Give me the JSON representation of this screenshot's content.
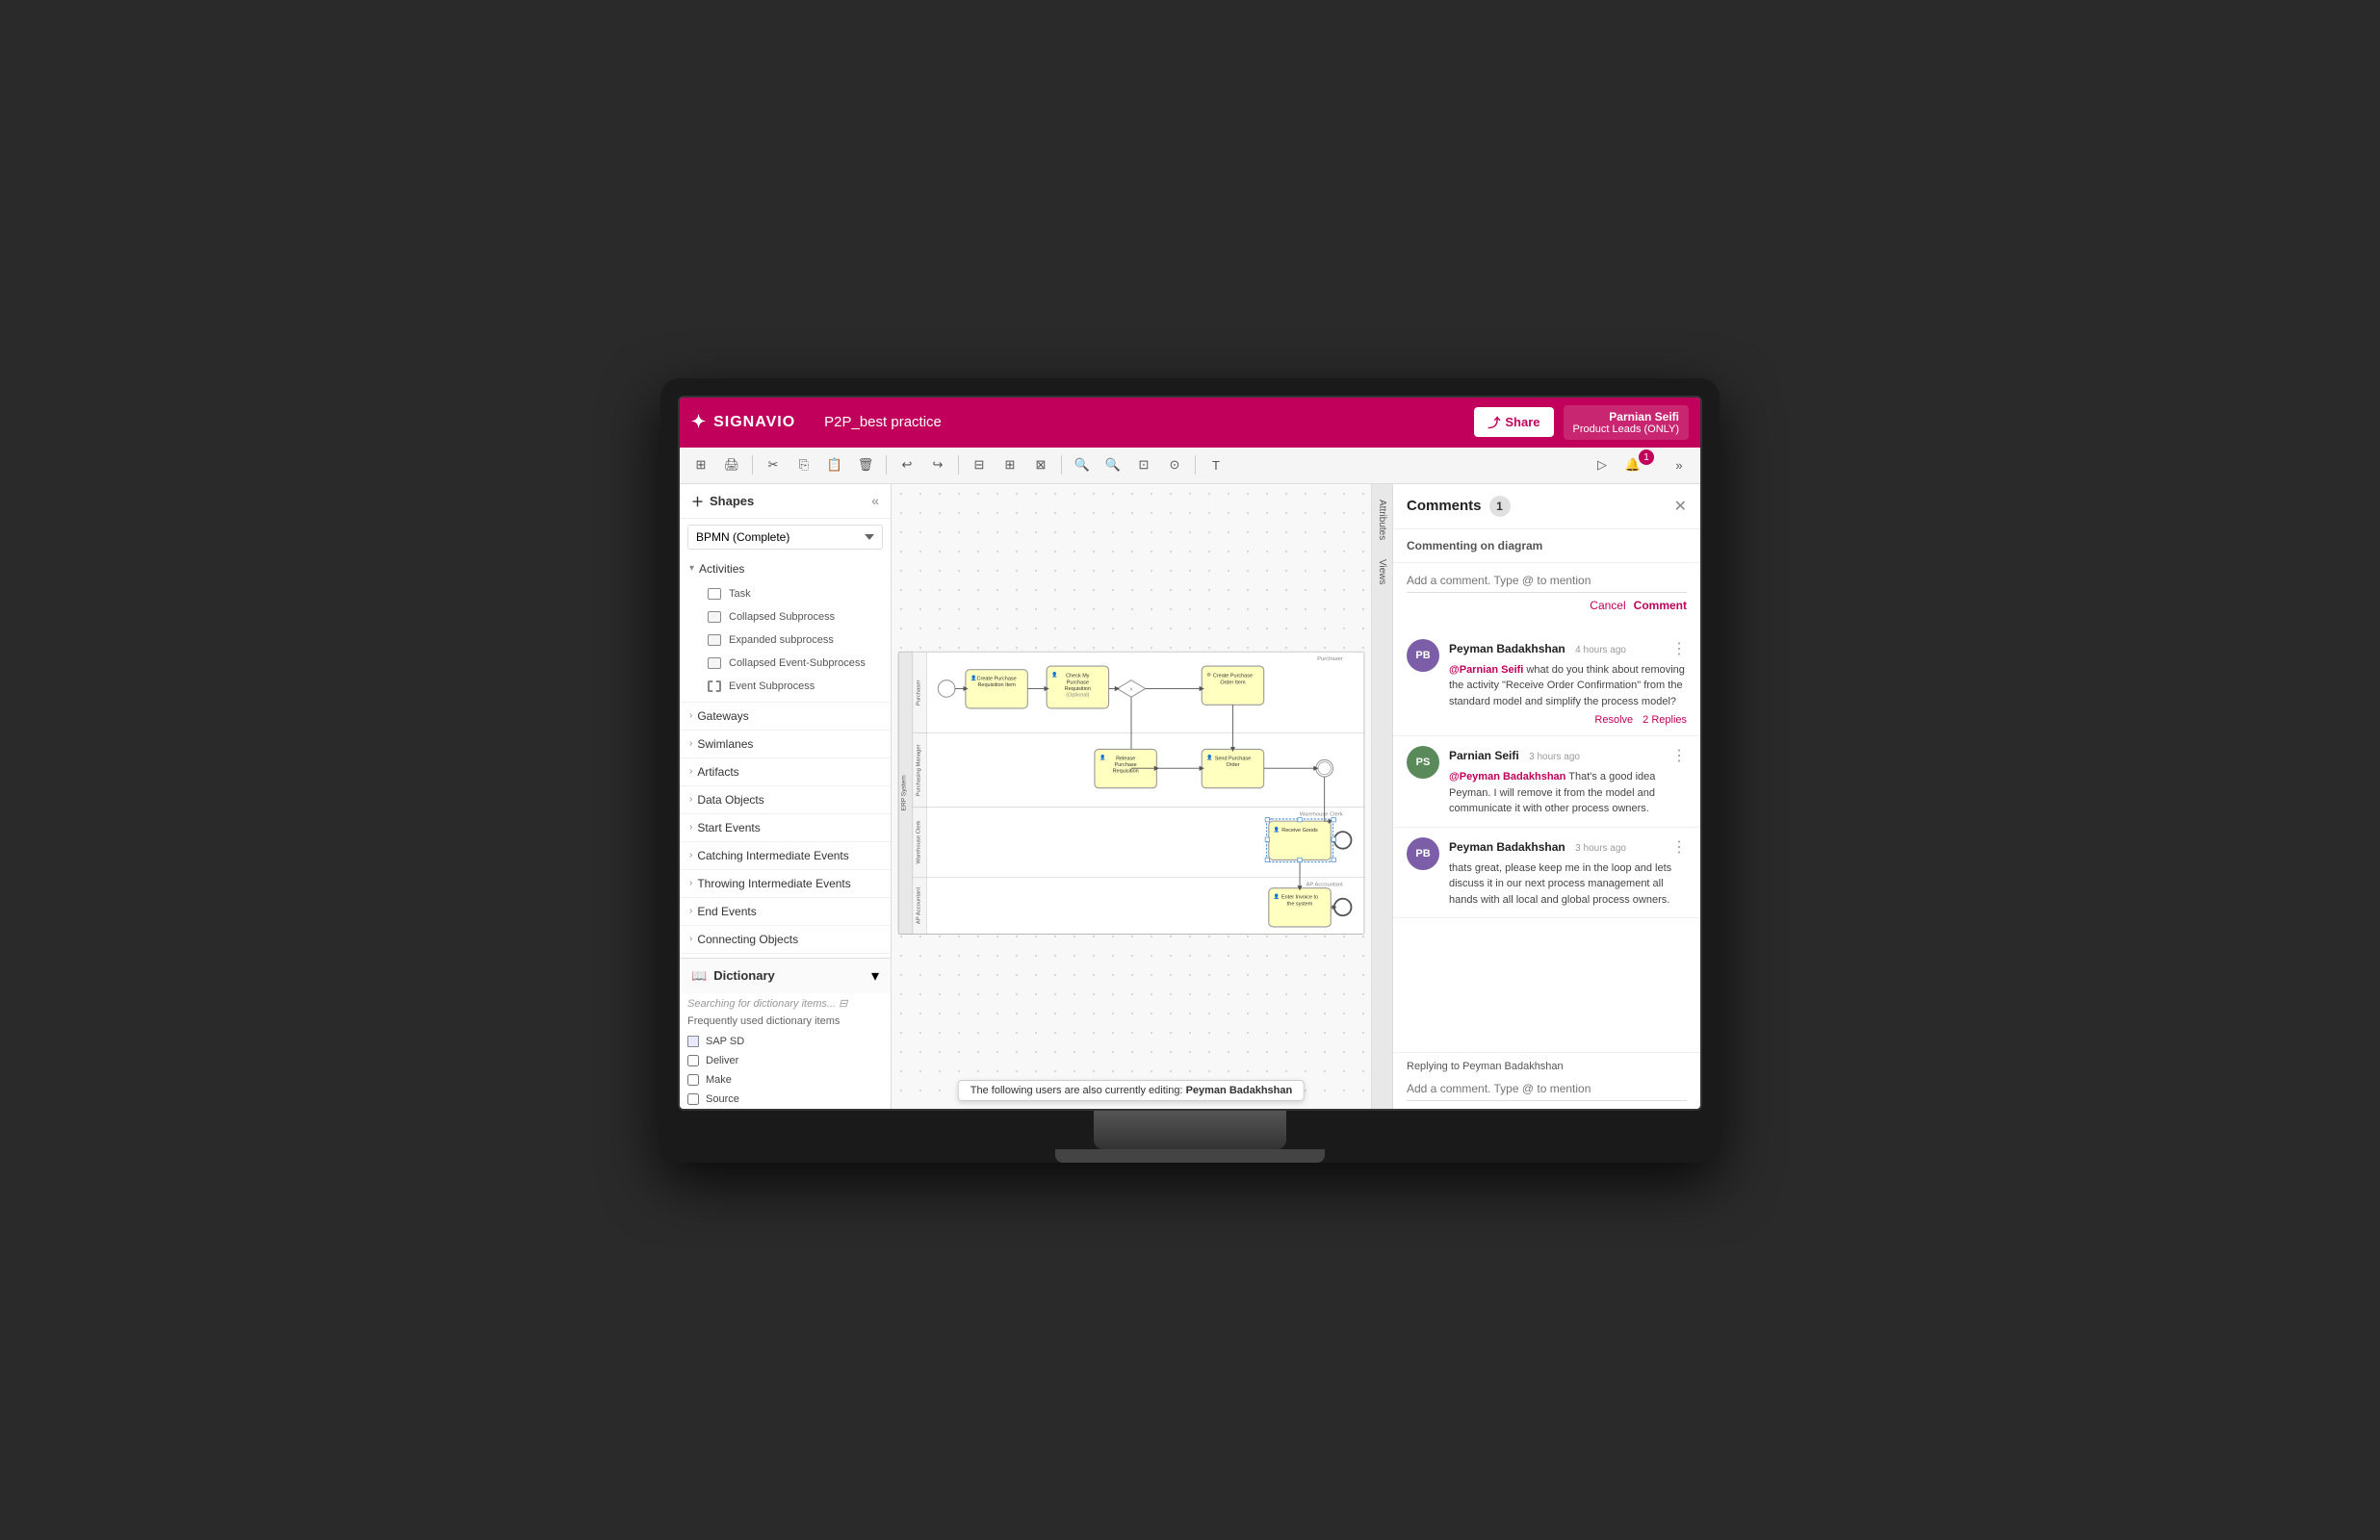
{
  "app": {
    "title": "SIGNAVIO",
    "diagram_name": "P2P_best practice"
  },
  "topbar": {
    "share_label": "Share",
    "user_name": "Parnian Seifi",
    "user_role": "Product Leads (ONLY)"
  },
  "left_panel": {
    "title": "Shapes",
    "bpmn_type": "BPMN (Complete)",
    "categories": [
      {
        "id": "activities",
        "label": "Activities",
        "items": [
          {
            "label": "Task",
            "icon": "task"
          },
          {
            "label": "Collapsed Subprocess",
            "icon": "collapsed"
          },
          {
            "label": "Expanded subprocess",
            "icon": "expanded"
          },
          {
            "label": "Collapsed Event-Subprocess",
            "icon": "collapsed"
          },
          {
            "label": "Event Subprocess",
            "icon": "dashed"
          }
        ]
      },
      {
        "id": "gateways",
        "label": "Gateways",
        "items": []
      },
      {
        "id": "swimlanes",
        "label": "Swimlanes",
        "items": []
      },
      {
        "id": "artifacts",
        "label": "Artifacts",
        "items": []
      },
      {
        "id": "data_objects",
        "label": "Data Objects",
        "items": []
      },
      {
        "id": "start_events",
        "label": "Start Events",
        "items": []
      },
      {
        "id": "catching_intermediate",
        "label": "Catching Intermediate Events",
        "items": []
      },
      {
        "id": "throwing_intermediate",
        "label": "Throwing Intermediate Events",
        "items": []
      },
      {
        "id": "end_events",
        "label": "End Events",
        "items": []
      },
      {
        "id": "connecting_objects",
        "label": "Connecting Objects",
        "items": []
      }
    ],
    "dictionary": {
      "title": "Dictionary",
      "search_text": "Searching for dictionary items...",
      "subtitle": "Frequently used dictionary items",
      "items": [
        {
          "label": "SAP SD",
          "type": "square"
        },
        {
          "label": "Deliver",
          "type": "checkbox"
        },
        {
          "label": "Make",
          "type": "checkbox"
        },
        {
          "label": "Source",
          "type": "checkbox"
        }
      ]
    }
  },
  "diagram": {
    "pool_name": "ERP System",
    "lanes": [
      {
        "label": "Purchaser",
        "header_label": "Purchaser"
      },
      {
        "label": "Purchasing Manager",
        "header_label": "Purchasing Manager"
      },
      {
        "label": "Warehouse Clerk",
        "header_label": "Warehouse Clerk"
      },
      {
        "label": "AP Accountant",
        "header_label": "AP Accountant"
      }
    ],
    "tasks": [
      {
        "id": "t1",
        "label": "Create Purchase Requisition Item",
        "icon": "user"
      },
      {
        "id": "t2",
        "label": "Check My Purchase Requisition (Optional)",
        "icon": "user"
      },
      {
        "id": "t3",
        "label": "Create Purchase Order Item",
        "icon": "service"
      },
      {
        "id": "t4",
        "label": "Release Purchase Requisition",
        "icon": "user"
      },
      {
        "id": "t5",
        "label": "Send Purchase Order",
        "icon": "user"
      },
      {
        "id": "t6",
        "label": "Receive Goods",
        "icon": "user"
      },
      {
        "id": "t7",
        "label": "Enter Invoice to the system",
        "icon": "user"
      }
    ]
  },
  "status_bar": {
    "text": "The following users are also currently editing:",
    "user": "Peyman Badakhshan"
  },
  "side_tabs": {
    "tabs": [
      "Attributes",
      "Views"
    ]
  },
  "comments": {
    "title": "Comments",
    "count": 1,
    "on_diagram_label": "Commenting on diagram",
    "input_placeholder": "Add a comment. Type @ to mention",
    "cancel_label": "Cancel",
    "comment_label": "Comment",
    "items": [
      {
        "id": "c1",
        "avatar": "PB",
        "avatar_class": "avatar-pb",
        "name": "Peyman Badakhshan",
        "time": "4 hours ago",
        "mention": "@Parnian Seifi",
        "text": " what do you think about removing the activity \"Receive Order Confirmation\" from the standard model and simplify the process model?",
        "resolve_label": "Resolve",
        "replies_label": "2 Replies"
      },
      {
        "id": "c2",
        "avatar": "PS",
        "avatar_class": "avatar-ps",
        "name": "Parnian Seifi",
        "time": "3 hours ago",
        "mention": "@Peyman Badakhshan",
        "text": " That's a good idea Peyman. I will remove it from the model and communicate it with other process owners."
      },
      {
        "id": "c3",
        "avatar": "PB",
        "avatar_class": "avatar-pb",
        "name": "Peyman Badakhshan",
        "time": "3 hours ago",
        "mention": "",
        "text": "thats great, please keep me in the loop and lets discuss it in our next process management all hands with all local and global process owners."
      }
    ],
    "replying_to": "Replying to Peyman Badakhshan",
    "reply_placeholder": "Add a comment. Type @ to mention"
  }
}
